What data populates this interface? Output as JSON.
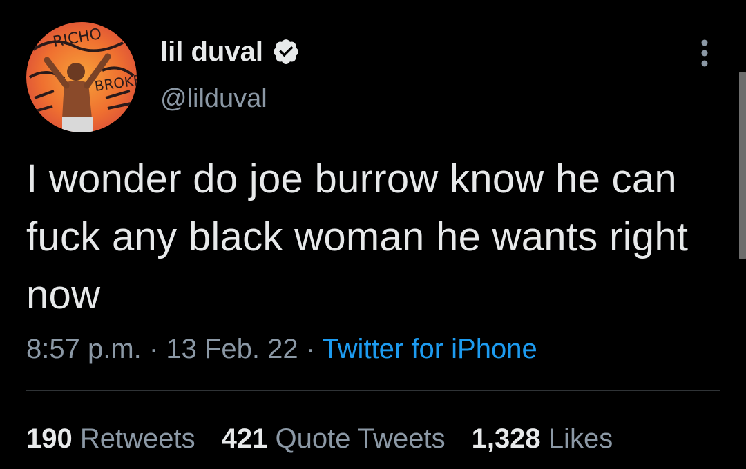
{
  "author": {
    "display_name": "lil duval",
    "handle": "@lilduval",
    "verified": true,
    "avatar_icon": "profile-photo",
    "avatar_art_text": [
      "RICHO",
      "BROKE"
    ]
  },
  "tweet": {
    "text": "I wonder do joe burrow know he can fuck any black woman he wants right now",
    "time": "8:57 p.m.",
    "date": "13 Feb. 22",
    "separator": "·",
    "source": "Twitter for iPhone"
  },
  "stats": [
    {
      "count": "190",
      "label": "Retweets"
    },
    {
      "count": "421",
      "label": "Quote Tweets"
    },
    {
      "count": "1,328",
      "label": "Likes"
    }
  ],
  "colors": {
    "background": "#000000",
    "text_primary": "#e7e9ea",
    "text_secondary": "#8b98a5",
    "link": "#1d9bf0",
    "divider": "#2f3336"
  },
  "icons": {
    "more": "more-vertical-icon",
    "verified": "verified-badge-icon"
  }
}
